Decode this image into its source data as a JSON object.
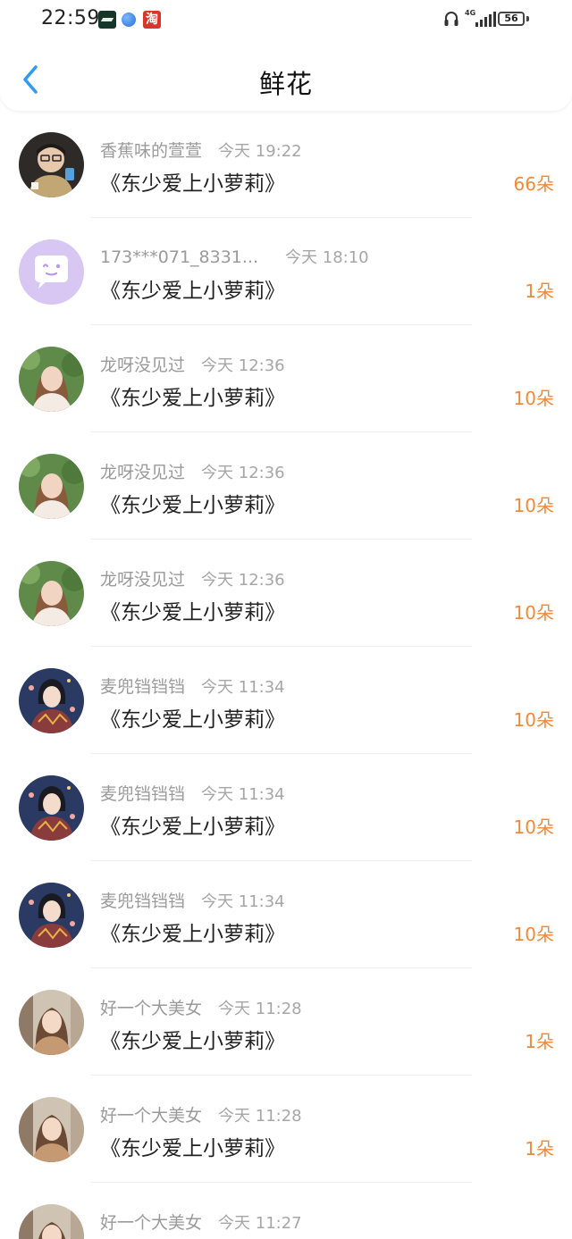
{
  "status_bar": {
    "time": "22:59",
    "app_icons": [
      "tracking-app-icon",
      "browser-app-icon",
      "taobao-app-icon"
    ],
    "taobao_glyph": "淘",
    "network_label": "4G",
    "battery": "56"
  },
  "header": {
    "title": "鲜花",
    "back_icon": "chevron-left-icon",
    "accent_color": "#2f9bf0"
  },
  "colors": {
    "count": "#ee8a3a",
    "meta": "#9a9a9a",
    "book": "#222222"
  },
  "items": [
    {
      "user": "香蕉味的萱萱",
      "time": "今天 19:22",
      "book": "《东少爱上小萝莉》",
      "count": "66朵",
      "avatar": "avatar-photo-boy"
    },
    {
      "user": "173***071_8331...",
      "time": "今天 18:10",
      "book": "《东少爱上小萝莉》",
      "count": "1朵",
      "avatar": "default-chat-avatar-icon"
    },
    {
      "user": "龙呀没见过",
      "time": "今天 12:36",
      "book": "《东少爱上小萝莉》",
      "count": "10朵",
      "avatar": "avatar-photo-girl"
    },
    {
      "user": "龙呀没见过",
      "time": "今天 12:36",
      "book": "《东少爱上小萝莉》",
      "count": "10朵",
      "avatar": "avatar-photo-girl"
    },
    {
      "user": "龙呀没见过",
      "time": "今天 12:36",
      "book": "《东少爱上小萝莉》",
      "count": "10朵",
      "avatar": "avatar-photo-girl"
    },
    {
      "user": "麦兜铛铛铛",
      "time": "今天 11:34",
      "book": "《东少爱上小萝莉》",
      "count": "10朵",
      "avatar": "avatar-illustration"
    },
    {
      "user": "麦兜铛铛铛",
      "time": "今天 11:34",
      "book": "《东少爱上小萝莉》",
      "count": "10朵",
      "avatar": "avatar-illustration"
    },
    {
      "user": "麦兜铛铛铛",
      "time": "今天 11:34",
      "book": "《东少爱上小萝莉》",
      "count": "10朵",
      "avatar": "avatar-illustration"
    },
    {
      "user": "好一个大美女",
      "time": "今天 11:28",
      "book": "《东少爱上小萝莉》",
      "count": "1朵",
      "avatar": "avatar-photo-woman"
    },
    {
      "user": "好一个大美女",
      "time": "今天 11:28",
      "book": "《东少爱上小萝莉》",
      "count": "1朵",
      "avatar": "avatar-photo-woman"
    },
    {
      "user": "好一个大美女",
      "time": "今天 11:27",
      "book": "",
      "count": "",
      "avatar": "avatar-photo-woman"
    }
  ]
}
